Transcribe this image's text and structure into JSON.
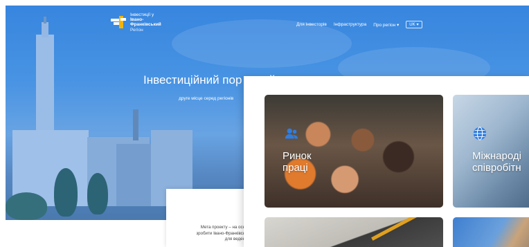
{
  "header": {
    "logo_line1": "Інвестиції у",
    "logo_line2": "Івано-",
    "logo_line3": "Франківський",
    "logo_line4": "Регіон"
  },
  "nav": {
    "items": [
      "Для інвесторів",
      "Інфраструктура",
      "Про регіон ▾"
    ],
    "language": "UK",
    "language_chevron": "▾"
  },
  "hero": {
    "title": "Інвестиційний пор                                  ський ..  .",
    "subtitle": "друге місце серед регіонів"
  },
  "intro": {
    "line1": "Мета проекту – на осн",
    "line2": "зробити Івано-Франківсь",
    "line3": "для веден"
  },
  "cards": [
    {
      "label_line1": "Ринок",
      "label_line2": "праці",
      "icon": "people-icon"
    },
    {
      "label_line1": "Міжнароді",
      "label_line2": "співробітн",
      "icon": "globe-icon"
    }
  ],
  "colors": {
    "accent": "#f4b400",
    "hero_blue": "#3f8de0",
    "card_icon_blue": "#2f7de0"
  }
}
